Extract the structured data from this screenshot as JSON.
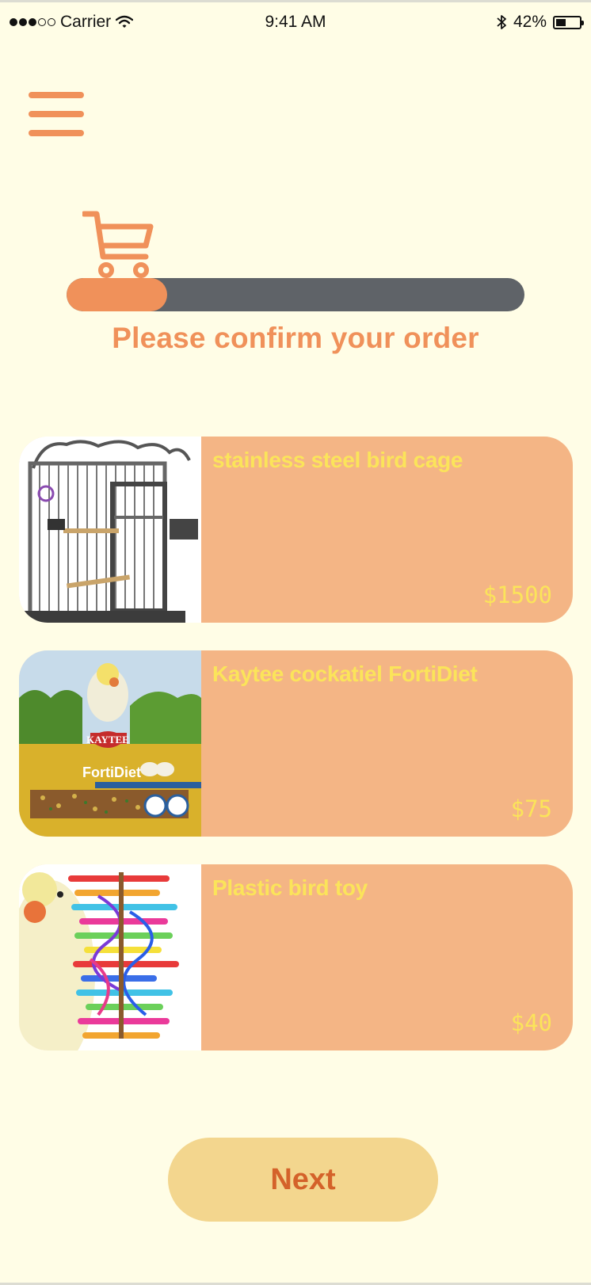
{
  "status_bar": {
    "carrier": "Carrier",
    "time": "9:41 AM",
    "battery": "42%",
    "battery_level": 0.42,
    "icons": [
      "signal-dots-icon",
      "wifi-icon",
      "bluetooth-icon",
      "battery-icon"
    ]
  },
  "header": {
    "menu_icon": "hamburger-menu-icon"
  },
  "progress": {
    "icon": "shopping-cart-icon",
    "value": 0.22,
    "title": "Please confirm your order"
  },
  "items": [
    {
      "name": "stainless steel bird cage",
      "price": "$1500",
      "image": "bird-cage-image"
    },
    {
      "name": "Kaytee cockatiel FortiDiet",
      "price": "$75",
      "image": "bird-food-bag-image"
    },
    {
      "name": "Plastic bird toy",
      "price": "$40",
      "image": "bird-toy-image"
    }
  ],
  "next_label": "Next",
  "colors": {
    "background": "#fffde6",
    "accent": "#f0915a",
    "card": "#f4b585",
    "card_text": "#fbe45a",
    "track": "#5f6368",
    "button": "#f3d68e",
    "button_text": "#d4622a"
  }
}
